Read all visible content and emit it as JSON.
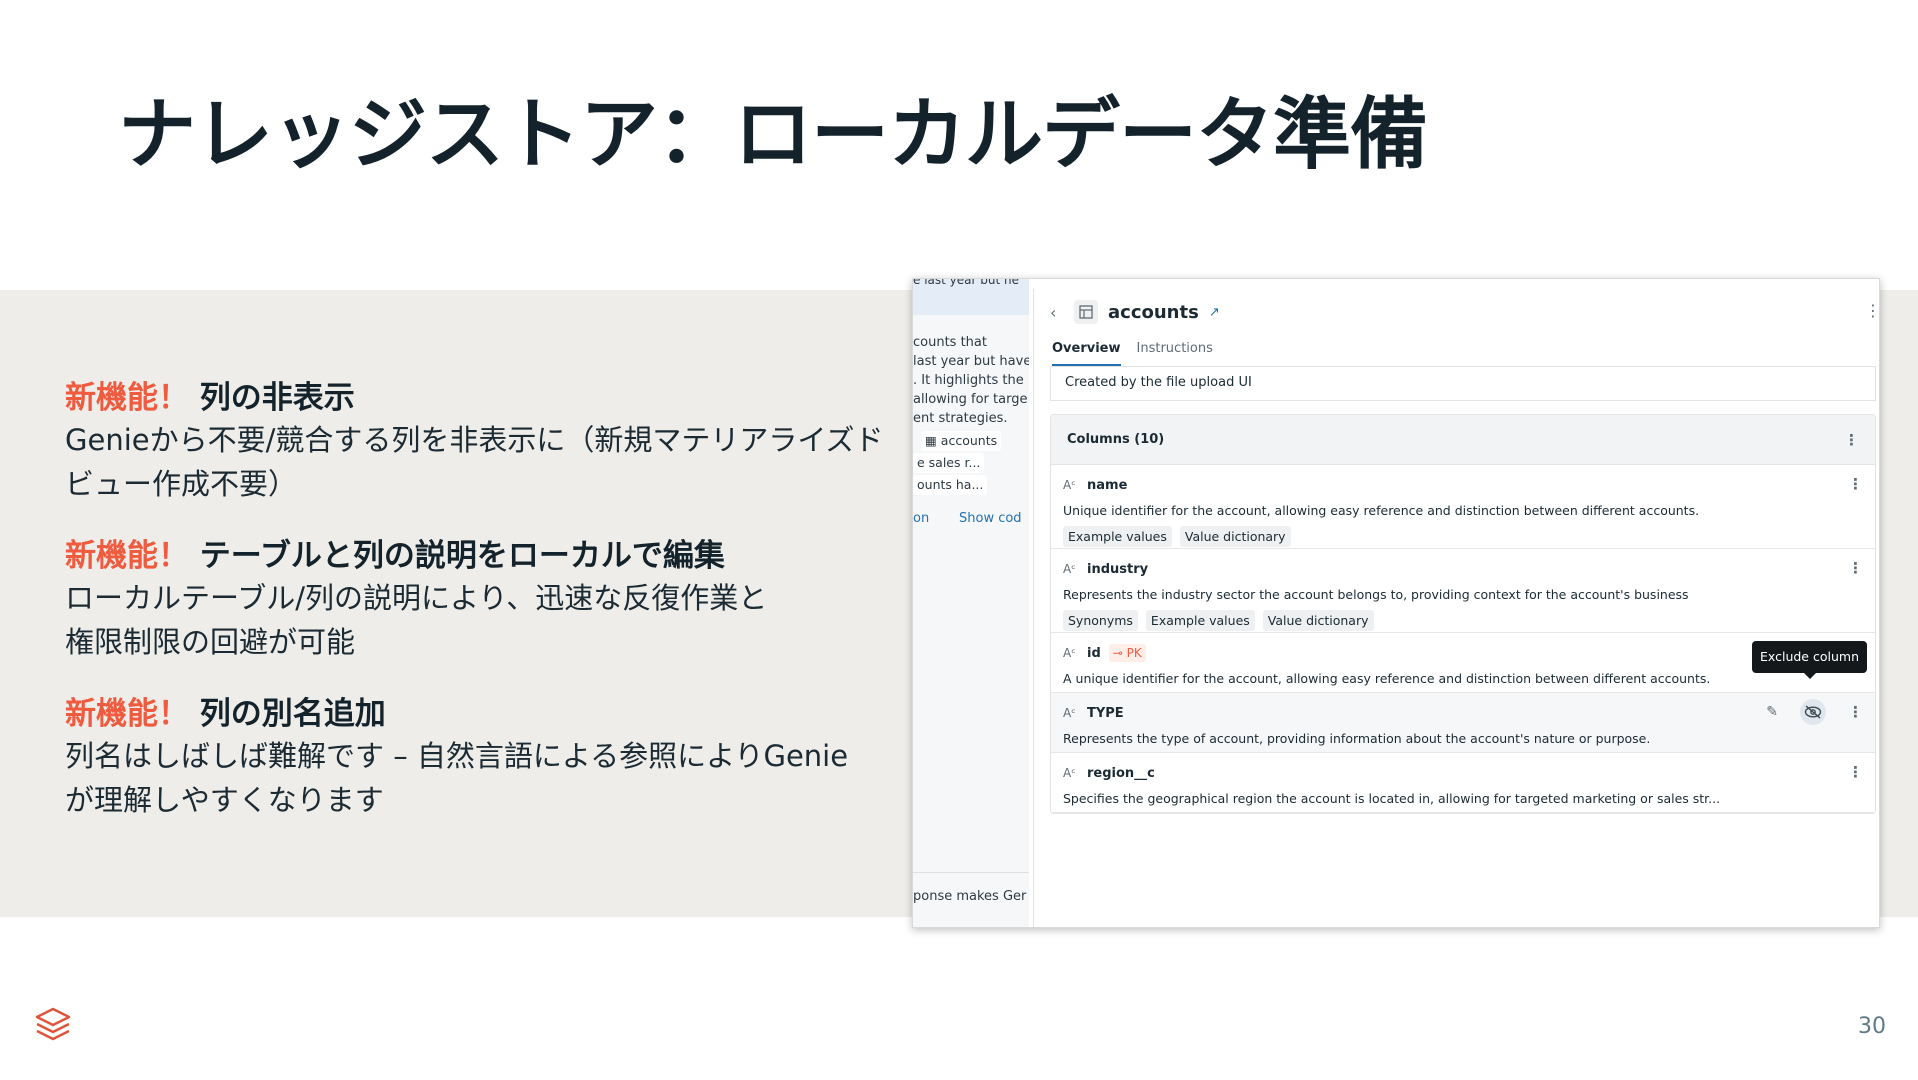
{
  "slide": {
    "title": "ナレッジストア：ローカルデータ準備",
    "page_number": "30"
  },
  "features": [
    {
      "new_label": "新機能！",
      "title": "列の非表示",
      "description_lines": [
        "Genieから不要/競合する列を非表示に（新規マテリアライズド",
        "ビュー作成不要）"
      ]
    },
    {
      "new_label": "新機能！",
      "title": "テーブルと列の説明をローカルで編集",
      "description_lines": [
        "ローカルテーブル/列の説明により、迅速な反復作業と",
        "権限制限の回避が可能"
      ]
    },
    {
      "new_label": "新機能！",
      "title": "列の別名追加",
      "description_lines": [
        "列名はしばしば難解です – 自然言語による参照によりGenie",
        "が理解しやすくなります"
      ]
    }
  ],
  "screenshot": {
    "chat": {
      "top_snippet": "e last year but ne",
      "lines": [
        "counts that",
        "last year but have",
        ". It highlights the",
        "allowing for targe",
        "ent strategies."
      ],
      "chips": [
        "accounts",
        "e sales r...",
        "ounts ha..."
      ],
      "link_left": "on",
      "link_right": "Show cod",
      "footer": "ponse makes Ger"
    },
    "panel": {
      "title": "accounts",
      "tabs": [
        {
          "label": "Overview",
          "active": true
        },
        {
          "label": "Instructions",
          "active": false
        }
      ],
      "table_description": "Created by the file upload UI",
      "columns_header": "Columns (10)",
      "columns": [
        {
          "name": "name",
          "description": "Unique identifier for the account, allowing easy reference and distinction between different accounts.",
          "tags": [
            "Example values",
            "Value dictionary"
          ]
        },
        {
          "name": "industry",
          "description": "Represents the industry sector the account belongs to, providing context for the account's business",
          "tags": [
            "Synonyms",
            "Example values",
            "Value dictionary"
          ]
        },
        {
          "name": "id",
          "badge": "PK",
          "description": "A unique identifier for the account, allowing easy reference and distinction between different accounts.",
          "tags": []
        },
        {
          "name": "TYPE",
          "description": "Represents the type of account, providing information about the account's nature or purpose.",
          "tags": [],
          "tooltip": "Exclude column"
        },
        {
          "name": "region__c",
          "description": "Specifies the geographical region the account is located in, allowing for targeted marketing or sales str...",
          "tags": []
        }
      ]
    }
  },
  "colors": {
    "accent_new": "#ef5b3f",
    "title_text": "#14232b",
    "band_bg": "#eeedea",
    "link_blue": "#2272b4",
    "logo_red": "#e0533b"
  }
}
